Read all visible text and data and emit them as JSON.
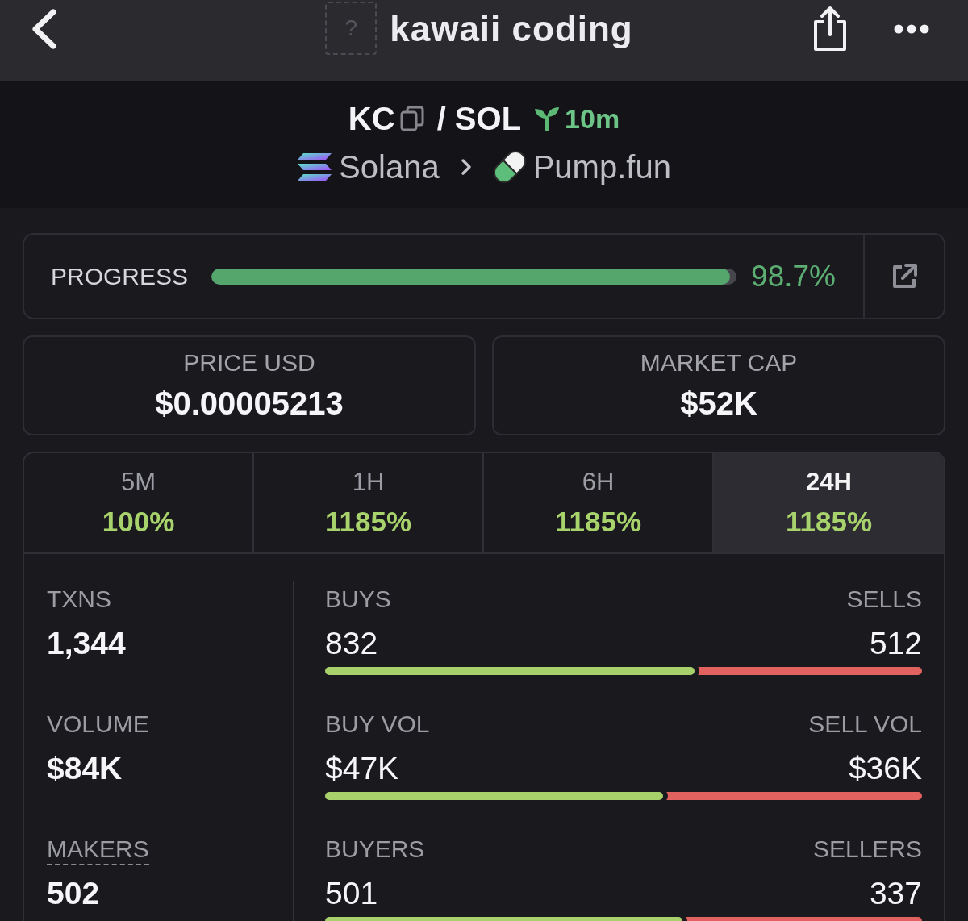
{
  "nav": {
    "title": "kawaii coding",
    "image_placeholder": "?"
  },
  "pair": {
    "base": "KC",
    "quote": "/ SOL",
    "age": "10m",
    "chain": "Solana",
    "dex": "Pump.fun"
  },
  "progress": {
    "label": "PROGRESS",
    "level": 0.987,
    "reading": "98.7%"
  },
  "stats": [
    {
      "label": "PRICE USD",
      "value": "$0.00005213"
    },
    {
      "label": "MARKET CAP",
      "value": "$52K"
    }
  ],
  "tabs": [
    {
      "label": "5M",
      "change": "100%",
      "selected": false
    },
    {
      "label": "1H",
      "change": "1185%",
      "selected": false
    },
    {
      "label": "6H",
      "change": "1185%",
      "selected": false
    },
    {
      "label": "24H",
      "change": "1185%",
      "selected": true
    }
  ],
  "metrics": [
    {
      "label": "TXNS",
      "value": "1,344",
      "dashed_underline": false,
      "buy_label": "BUYS",
      "buy_value": "832",
      "sell_label": "SELLS",
      "sell_value": "512",
      "level": 0.619
    },
    {
      "label": "VOLUME",
      "value": "$84K",
      "dashed_underline": false,
      "buy_label": "BUY VOL",
      "buy_value": "$47K",
      "sell_label": "SELL VOL",
      "sell_value": "$36K",
      "level": 0.566
    },
    {
      "label": "MAKERS",
      "value": "502",
      "dashed_underline": true,
      "buy_label": "BUYERS",
      "buy_value": "501",
      "sell_label": "SELLERS",
      "sell_value": "337",
      "level": 0.598
    }
  ]
}
